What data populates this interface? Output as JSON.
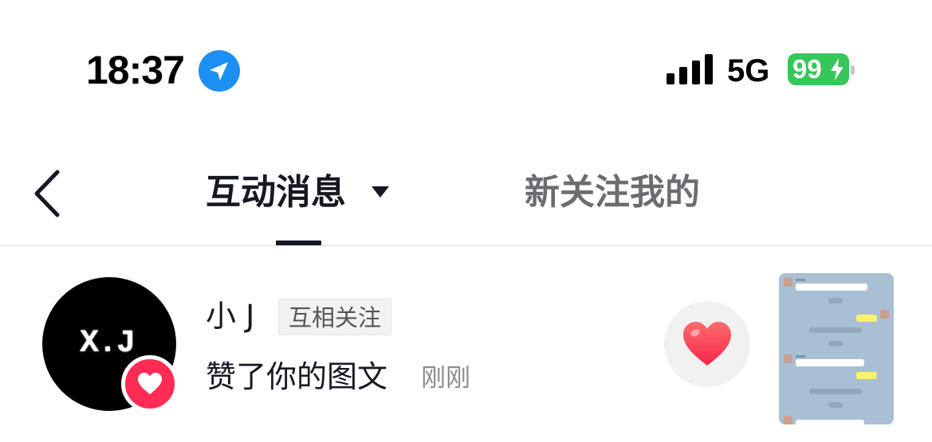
{
  "status_bar": {
    "time": "18:37",
    "network": "5G",
    "battery": "99",
    "location_icon": "location-arrow-icon",
    "signal_icon": "signal-bars-icon",
    "charging_icon": "bolt-icon"
  },
  "nav": {
    "back_icon": "chevron-left-icon",
    "tabs": [
      {
        "label": "互动消息",
        "active": true
      },
      {
        "label": "新关注我的",
        "active": false
      }
    ]
  },
  "notification": {
    "avatar_text": "X.J",
    "user_name": "小 J",
    "relation_tag": "互相关注",
    "action": "赞了你的图文",
    "time": "刚刚",
    "badge_icon": "heart-icon",
    "like_icon": "heart-icon"
  },
  "colors": {
    "accent": "#fe2c55",
    "location_blue": "#1c8ff2",
    "battery_green": "#36c759",
    "thumbnail_bg": "#a9bfd3"
  }
}
